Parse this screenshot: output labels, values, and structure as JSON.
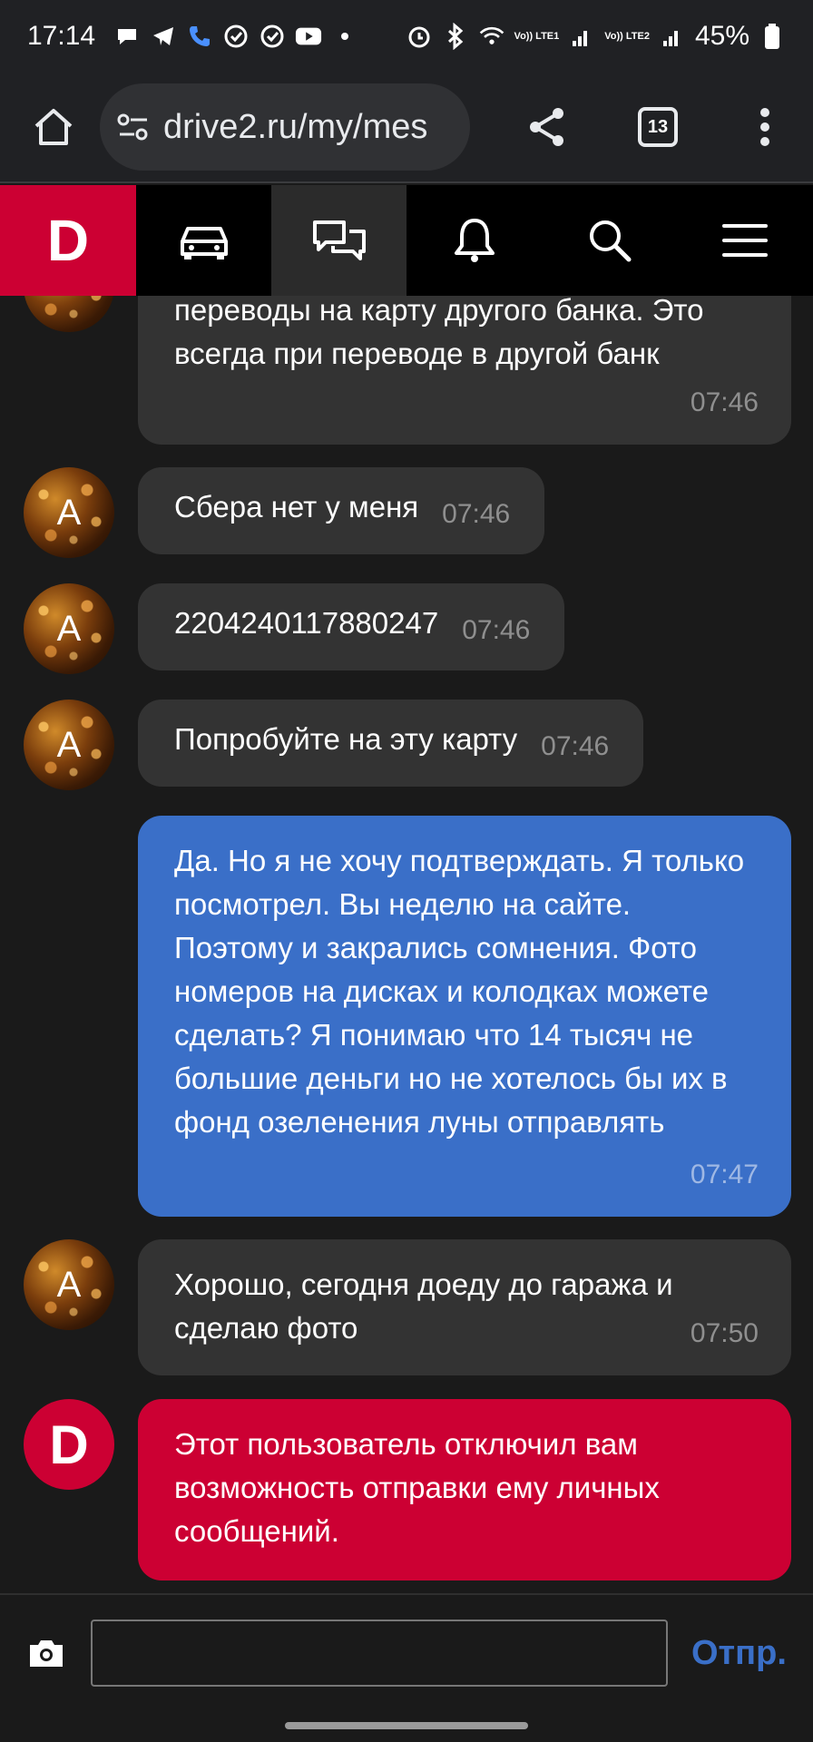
{
  "status_bar": {
    "time": "17:14",
    "battery": "45%",
    "lte1": "Vo)) LTE1",
    "lte2": "Vo)) LTE2"
  },
  "browser": {
    "url": "drive2.ru/my/mes",
    "tab_count": "13"
  },
  "site_nav": {
    "logo": "D",
    "items": [
      "cars-icon",
      "messages-icon",
      "notifications-icon",
      "search-icon",
      "menu-icon"
    ],
    "active": "messages-icon"
  },
  "messages": [
    {
      "from": "other",
      "text": "переводы на карту другого банка. Это всегда при переводе в другой банк",
      "time": "07:46"
    },
    {
      "from": "other",
      "avatar": "А",
      "text": "Сбера нет у меня",
      "time": "07:46"
    },
    {
      "from": "other",
      "avatar": "А",
      "text": "2204240117880247",
      "time": "07:46"
    },
    {
      "from": "other",
      "avatar": "А",
      "text": "Попробуйте на эту карту",
      "time": "07:46"
    },
    {
      "from": "me",
      "text": "Да. Но я не хочу подтверждать. Я только посмотрел. Вы неделю на сайте. Поэтому и закрались сомнения. Фото номеров на дисках и колодках можете сделать? Я понимаю что 14 тысяч не большие деньги но не хотелось бы их в фонд озеленения луны отправлять",
      "time": "07:47"
    },
    {
      "from": "other",
      "avatar": "А",
      "text": "Хорошо, сегодня доеду до гаража и сделаю фото",
      "time": "07:50"
    },
    {
      "from": "system",
      "avatar": "D",
      "text": "Этот пользователь отключил вам возможность отправки ему личных сообщений."
    }
  ],
  "composer": {
    "placeholder": "",
    "send_label": "Отпр."
  },
  "colors": {
    "brand_red": "#cc0033",
    "my_bubble": "#3a6fc8",
    "their_bubble": "#333333",
    "background": "#1a1a1a"
  }
}
